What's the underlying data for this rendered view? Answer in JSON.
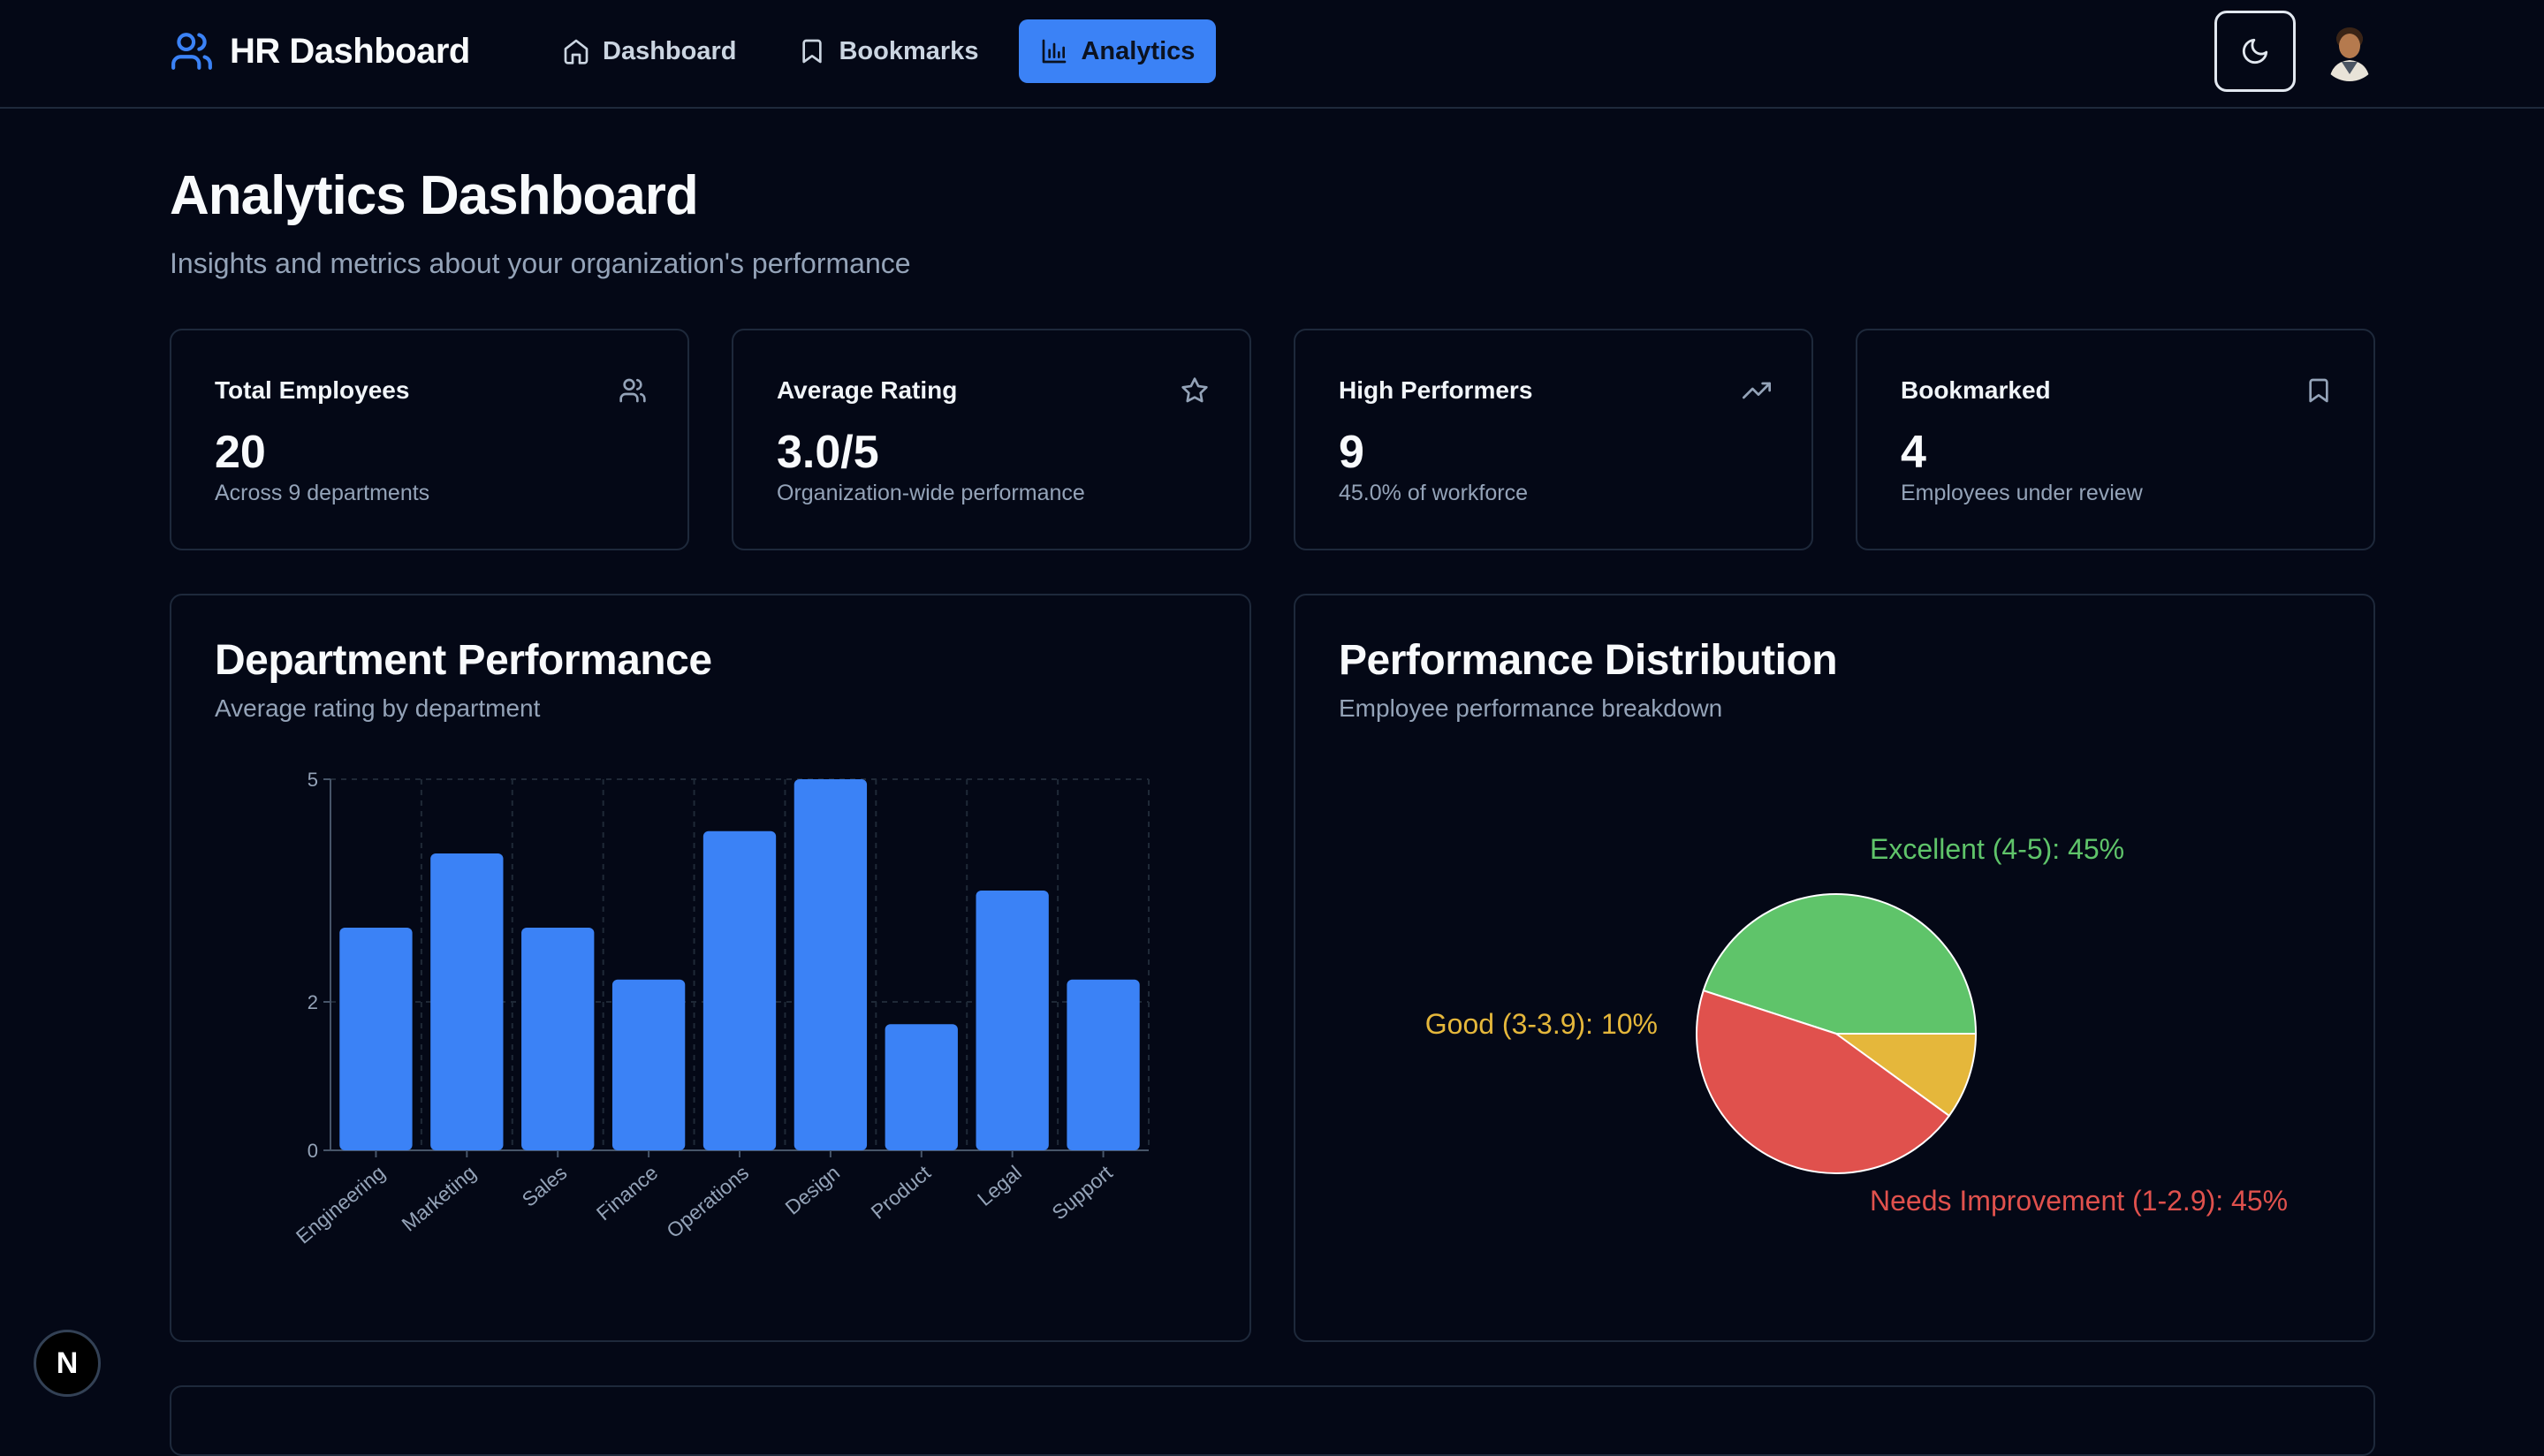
{
  "header": {
    "brand": "HR Dashboard",
    "nav": [
      {
        "label": "Dashboard",
        "icon": "home-icon"
      },
      {
        "label": "Bookmarks",
        "icon": "bookmark-icon"
      },
      {
        "label": "Analytics",
        "icon": "bar-chart-icon",
        "active": true
      }
    ],
    "theme_icon": "moon-icon",
    "avatar_icon": "user-avatar"
  },
  "page": {
    "title": "Analytics Dashboard",
    "subtitle": "Insights and metrics about your organization's performance"
  },
  "stats": [
    {
      "label": "Total Employees",
      "value": "20",
      "note": "Across 9 departments",
      "icon": "users-icon"
    },
    {
      "label": "Average Rating",
      "value": "3.0/5",
      "note": "Organization-wide performance",
      "icon": "star-icon"
    },
    {
      "label": "High Performers",
      "value": "9",
      "note": "45.0% of workforce",
      "icon": "trending-up-icon"
    },
    {
      "label": "Bookmarked",
      "value": "4",
      "note": "Employees under review",
      "icon": "bookmark-icon"
    }
  ],
  "dept_panel": {
    "title": "Department Performance",
    "subtitle": "Average rating by department"
  },
  "dist_panel": {
    "title": "Performance Distribution",
    "subtitle": "Employee performance breakdown"
  },
  "badge": "N",
  "colors": {
    "accent": "#3b82f6",
    "excellent": "#5fc46a",
    "good": "#e5b73b",
    "needs_improvement": "#e0514d"
  },
  "chart_data": [
    {
      "type": "bar",
      "title": "Department Performance",
      "categories": [
        "Engineering",
        "Marketing",
        "Sales",
        "Finance",
        "Operations",
        "Design",
        "Product",
        "Legal",
        "Support"
      ],
      "values": [
        3.0,
        4.0,
        3.0,
        2.3,
        4.3,
        5.0,
        1.7,
        3.5,
        2.3
      ],
      "yticks": [
        0,
        2,
        5
      ],
      "ylim": [
        0,
        5
      ],
      "grid": true
    },
    {
      "type": "pie",
      "title": "Performance Distribution",
      "slices": [
        {
          "label": "Excellent (4-5): 45%",
          "value": 45,
          "color": "#5fc46a"
        },
        {
          "label": "Needs Improvement (1-2.9): 45%",
          "value": 45,
          "color": "#e0514d"
        },
        {
          "label": "Good (3-3.9): 10%",
          "value": 10,
          "color": "#e5b73b"
        }
      ]
    }
  ]
}
